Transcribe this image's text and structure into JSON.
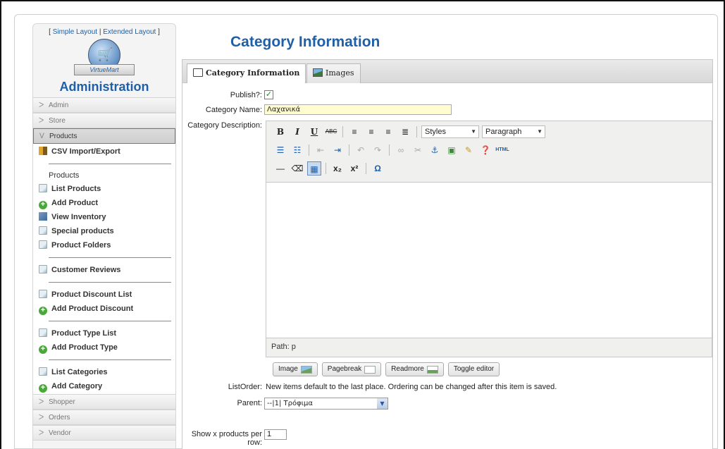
{
  "sidebar": {
    "layout_open": "[ ",
    "layout_simple": "Simple Layout",
    "layout_sep": " | ",
    "layout_extended": "Extended Layout",
    "layout_close": " ]",
    "logo_text": "VirtueMart",
    "title": "Administration",
    "menus": {
      "admin": "Admin",
      "store": "Store",
      "products": "Products",
      "shopper": "Shopper",
      "orders": "Orders",
      "vendor": "Vendor"
    },
    "items": {
      "csv": "CSV Import/Export",
      "products_group": "Products",
      "list_products": "List Products",
      "add_product": "Add Product",
      "view_inventory": "View Inventory",
      "special_products": "Special products",
      "product_folders": "Product Folders",
      "customer_reviews": "Customer Reviews",
      "discount_list": "Product Discount List",
      "add_discount": "Add Product Discount",
      "type_list": "Product Type List",
      "add_type": "Add Product Type",
      "list_categories": "List Categories",
      "add_category": "Add Category"
    }
  },
  "main": {
    "title": "Category Information",
    "tabs": {
      "info": "Category Information",
      "images": "Images"
    },
    "form": {
      "publish_label": "Publish?:",
      "publish_checked": "✓",
      "name_label": "Category Name:",
      "name_value": "Λαχανικά",
      "desc_label": "Category Description:",
      "listorder_label": "ListOrder:",
      "listorder_note": "New items default to the last place. Ordering can be changed after this item is saved.",
      "parent_label": "Parent:",
      "parent_value": "--|1| Τρόφιμα",
      "perrow_label_1": "Show x products per",
      "perrow_label_2": "row:",
      "perrow_value": "1"
    },
    "editor": {
      "styles": "Styles",
      "paragraph": "Paragraph",
      "path": "Path: p",
      "buttons": {
        "image": "Image",
        "pagebreak": "Pagebreak",
        "readmore": "Readmore",
        "toggle": "Toggle editor"
      }
    }
  },
  "colors": {
    "accent": "#1f5fa8",
    "name_field_bg": "#fffccf"
  }
}
